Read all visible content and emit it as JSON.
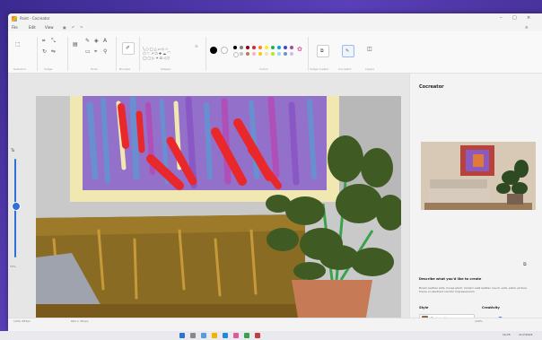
{
  "window": {
    "title": "Paint - Cocreator"
  },
  "menu": {
    "file": "File",
    "edit": "Edit",
    "view": "View"
  },
  "ribbon": {
    "groups": {
      "selection": "Selection",
      "image": "Image",
      "tools": "Tools",
      "brushes": "Brushes",
      "shapes": "Shapes",
      "colors": "Colors",
      "image_creator": "Image Creator",
      "cocreator": "Cocreator",
      "layers": "Layers"
    },
    "swatches": [
      "#000000",
      "#7f7f7f",
      "#880015",
      "#ed1c24",
      "#ff7f27",
      "#fff200",
      "#22b14c",
      "#00a2e8",
      "#3f48cc",
      "#a349a4",
      "#ffffff",
      "#c3c3c3",
      "#b97a57",
      "#ffaec9",
      "#ffc90e",
      "#efe4b0",
      "#b5e61d",
      "#99d9ea",
      "#7092be",
      "#c8bfe7"
    ],
    "primary_color": "#000000",
    "secondary_color": "#ffffff"
  },
  "zoom": {
    "label": "Ta",
    "level": "50%"
  },
  "side_panel": {
    "title": "Cocreator",
    "describe_label": "Describe what you'd like to create",
    "describe_text": "Brown leather sofa, house plant, modern wall leather couch, sofa, plant, picture frame on abstract colorful impressionism",
    "style_label": "Style",
    "style_value": "Photorealism",
    "creativity_label": "Creativity",
    "creativity_level": 0.35
  },
  "status": {
    "position": "1254, 687px",
    "selection": "664 × 391px",
    "zoom": "100%"
  },
  "taskbar": {
    "time": "10:25",
    "date": "11/7/2023"
  }
}
